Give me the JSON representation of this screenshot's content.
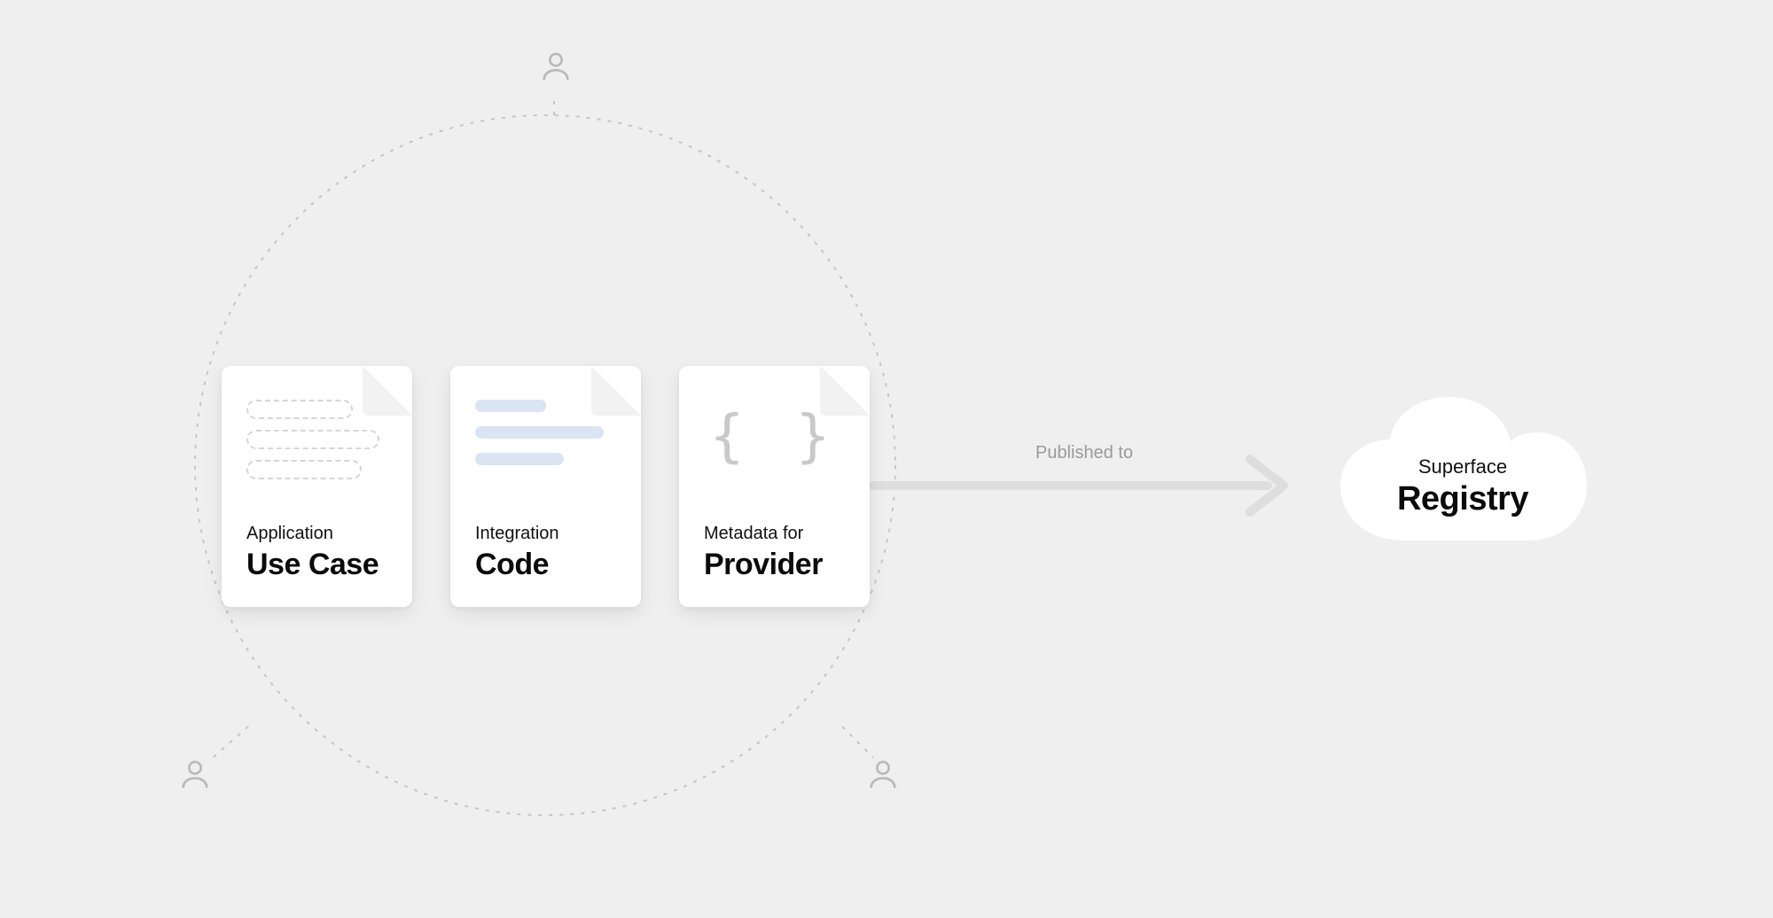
{
  "cards": [
    {
      "sub": "Application",
      "main": "Use Case"
    },
    {
      "sub": "Integration",
      "main": "Code"
    },
    {
      "sub": "Metadata for",
      "main": "Provider"
    }
  ],
  "arrow_label": "Published to",
  "cloud": {
    "sub": "Superface",
    "main": "Registry"
  },
  "brace_glyph": "{ }"
}
